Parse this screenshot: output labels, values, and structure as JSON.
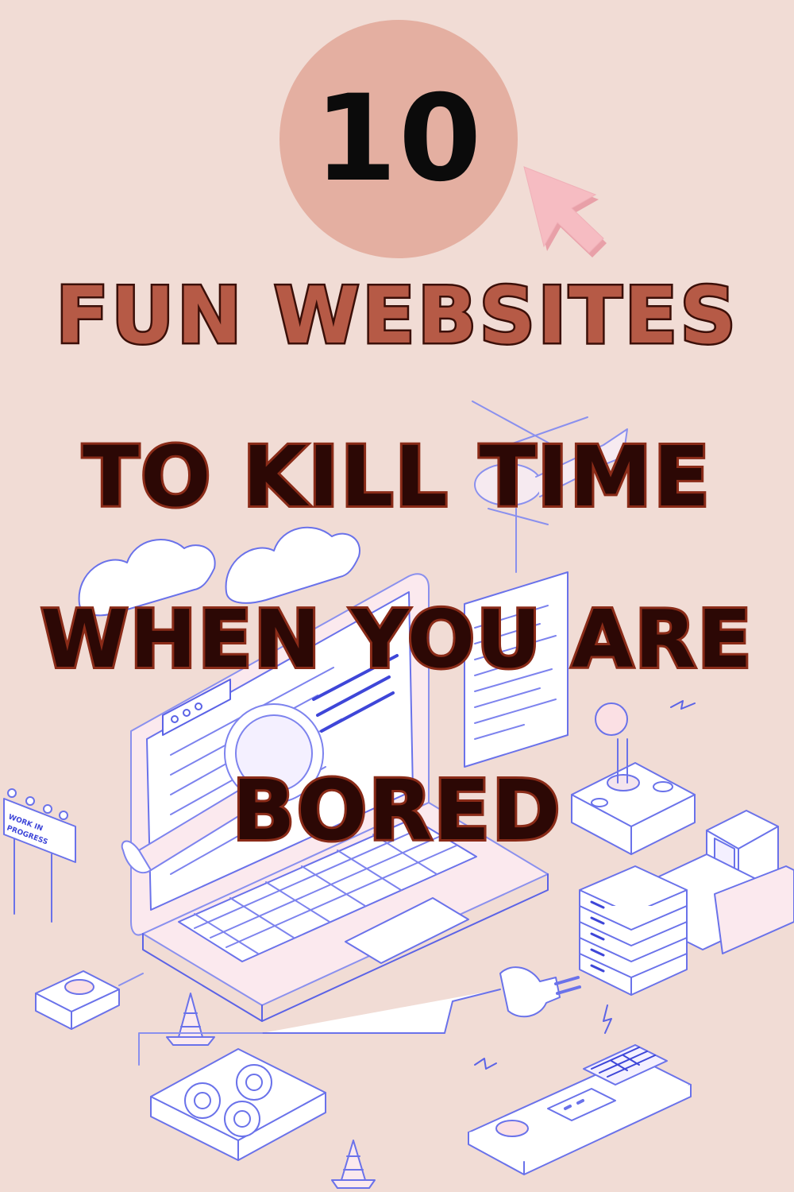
{
  "badge": {
    "number": "10"
  },
  "title": {
    "line1": "FUN WEBSITES",
    "line2": "TO KILL TIME",
    "line3": "WHEN YOU ARE",
    "line4": "BORED"
  },
  "sign": {
    "line1": "WORK IN",
    "line2": "PROGRESS"
  },
  "colors": {
    "background": "#f1dcd5",
    "badge_circle": "#e4afa1",
    "cursor": "#f1b6b6",
    "title_fill": "#b65a46",
    "title_outline": "#3b0f08",
    "line_art": "#5b63e6"
  },
  "icons": [
    "cursor-arrow-icon",
    "laptop-icon",
    "magnifier-icon",
    "cloud-icon",
    "helicopter-icon",
    "joystick-icon",
    "server-rack-icon",
    "bulldozer-icon",
    "traffic-cone-icon",
    "gears-icon",
    "power-plug-icon",
    "lightning-icon",
    "button-icon",
    "control-panel-icon",
    "work-in-progress-sign-icon"
  ]
}
